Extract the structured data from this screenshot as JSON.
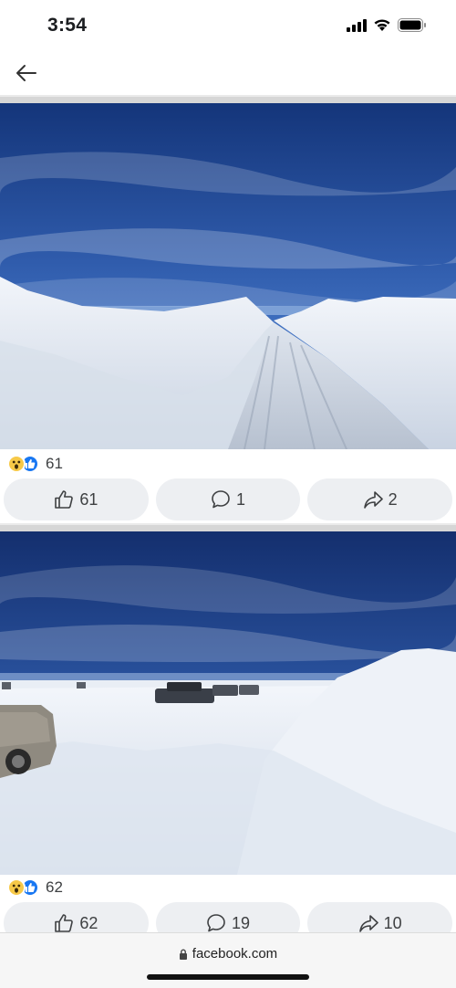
{
  "status_bar": {
    "time": "3:54"
  },
  "posts": [
    {
      "reaction_count": "61",
      "actions": {
        "like_count": "61",
        "comment_count": "1",
        "share_count": "2"
      }
    },
    {
      "reaction_count": "62",
      "actions": {
        "like_count": "62",
        "comment_count": "19",
        "share_count": "10"
      }
    }
  ],
  "browser": {
    "url": "facebook.com"
  },
  "colors": {
    "like_blue": "#1877f2",
    "wow_yellow": "#f7c948",
    "button_bg": "#edeff2"
  }
}
